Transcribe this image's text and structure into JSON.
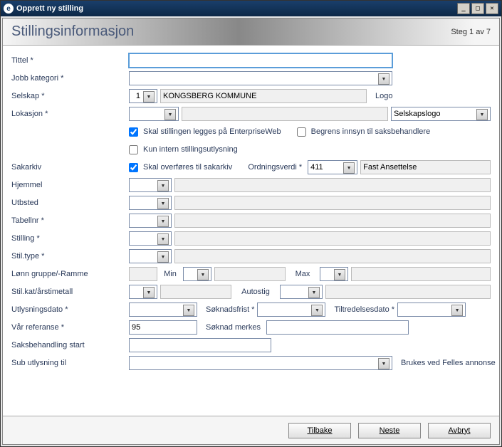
{
  "window": {
    "title": "Opprett ny stilling"
  },
  "header": {
    "title": "Stillingsinformasjon",
    "step": "Steg 1 av 7"
  },
  "labels": {
    "tittel": "Tittel *",
    "jobbkat": "Jobb kategori *",
    "selskap": "Selskap *",
    "lokasjon": "Lokasjon *",
    "logo": "Logo",
    "cb_ew": "Skal stillingen legges på EnterpriseWeb",
    "cb_beg": "Begrens innsyn til saksbehandlere",
    "cb_int": "Kun intern stillingsutlysning",
    "sakarkiv": "Sakarkiv",
    "cb_sak": "Skal overføres til sakarkiv",
    "ordning": "Ordningsverdi *",
    "hjemmel": "Hjemmel",
    "utbsted": "Utbsted",
    "tabellnr": "Tabellnr *",
    "stilling": "Stilling *",
    "stiltype": "Stil.type *",
    "lonn": "Lønn gruppe/-Ramme",
    "min": "Min",
    "max": "Max",
    "stilkat": "Stil.kat/årstimetall",
    "autostig": "Autostig",
    "utlysdato": "Utlysningsdato *",
    "sokfrist": "Søknadsfrist *",
    "tiltred": "Tiltredelsesdato *",
    "varref": "Vår referanse *",
    "sokmerk": "Søknad merkes",
    "saksstart": "Saksbehandling start",
    "subutlys": "Sub utlysning til",
    "brukes": "Brukes ved Felles annonse"
  },
  "values": {
    "tittel": "",
    "selskap_num": "1",
    "selskap_name": "KONGSBERG KOMMUNE",
    "logo_sel": "Selskapslogo",
    "ordning": "411",
    "ordning_desc": "Fast Ansettelse",
    "varref": "95"
  },
  "footer": {
    "tilbake": "Tilbake",
    "neste": "Neste",
    "avbryt": "Avbryt"
  }
}
